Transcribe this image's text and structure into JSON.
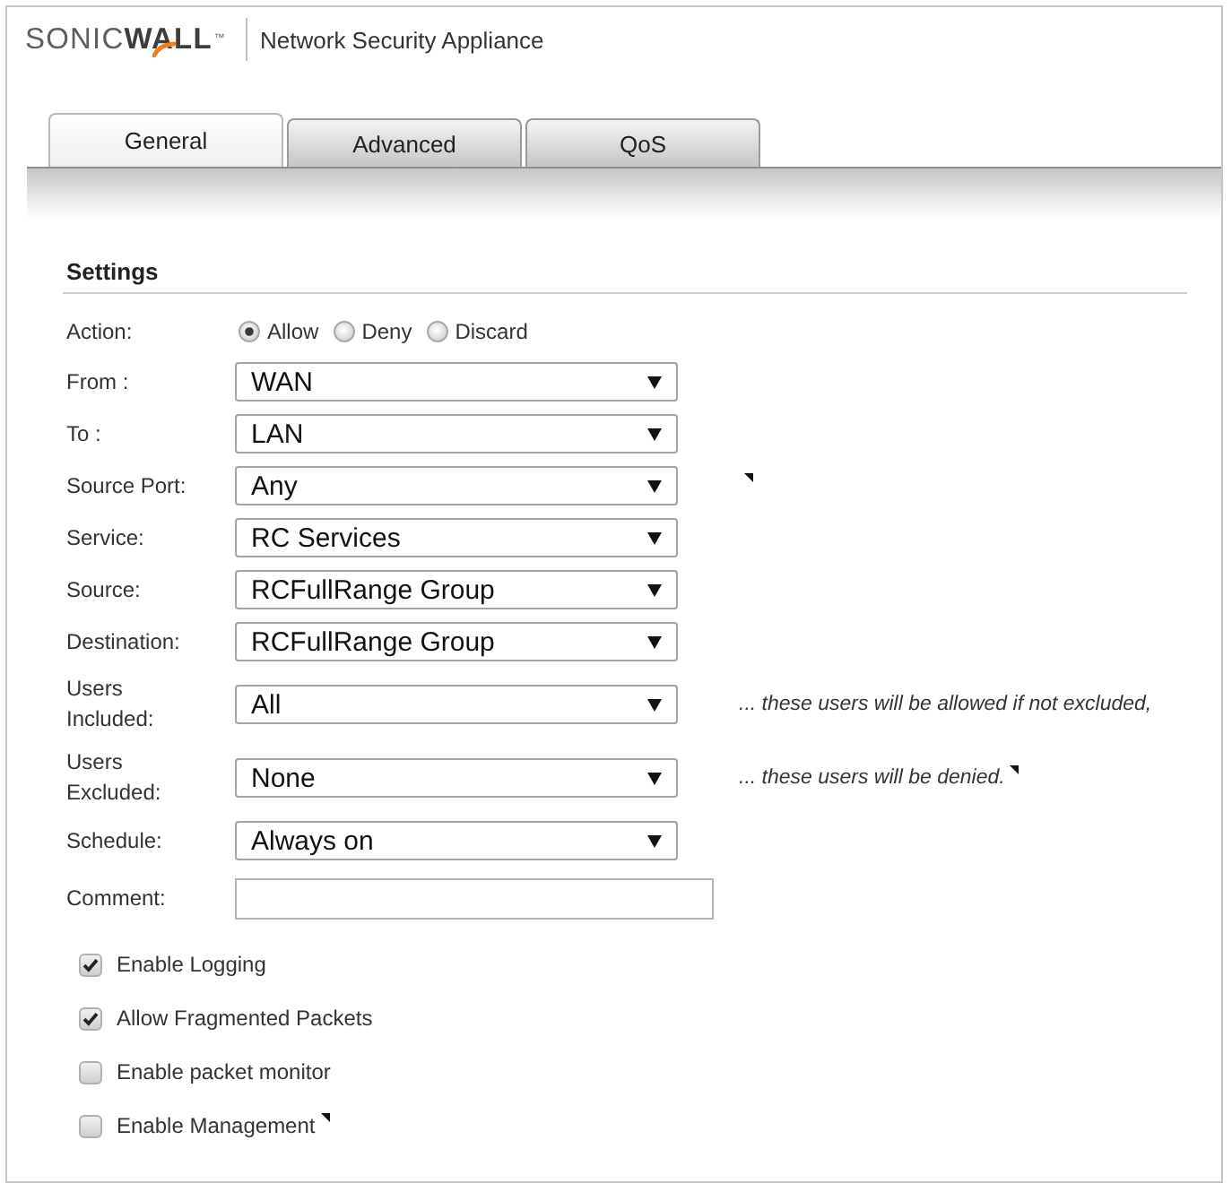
{
  "header": {
    "logo": "SONIC**WALL**$^{™}$",
    "product": "Network Security Appliance"
  },
  "tabs": [
    {
      "label": "General",
      "selected": true
    },
    {
      "label": "Advanced",
      "selected": false
    },
    {
      "label": "QoS",
      "selected": false
    }
  ],
  "settings": {
    "title": "Settings",
    "action": {
      "label": "Action:",
      "options": [
        {
          "label": "Allow",
          "selected": true
        },
        {
          "label": "Deny",
          "selected": false
        },
        {
          "label": "Discard",
          "selected": false
        }
      ]
    },
    "fields": [
      {
        "kind": "select",
        "label": "From :",
        "value": "WAN",
        "tooltip": false
      },
      {
        "kind": "select",
        "label": "To :",
        "value": "LAN",
        "tooltip": false
      },
      {
        "kind": "select",
        "label": "Source Port:",
        "value": "Any",
        "tooltip": true
      },
      {
        "kind": "select",
        "label": "Service:",
        "value": "RC Services",
        "tooltip": false
      },
      {
        "kind": "select",
        "label": "Source:",
        "value": "RCFullRange Group",
        "tooltip": false
      },
      {
        "kind": "select",
        "label": "Destination:",
        "value": "RCFullRange Group",
        "tooltip": false
      },
      {
        "kind": "select",
        "label": "Users Included:",
        "value": "All",
        "note": "... these users will be allowed if not excluded,",
        "tooltip": false
      },
      {
        "kind": "select",
        "label": "Users Excluded:",
        "value": "None",
        "note": "... these users will be denied.",
        "tooltip": true
      },
      {
        "kind": "select",
        "label": "Schedule:",
        "value": "Always on",
        "tooltip": false
      },
      {
        "kind": "text",
        "label": "Comment:",
        "tooltip": false
      }
    ],
    "options": [
      {
        "label": "Enable Logging",
        "checked": true,
        "tooltip": false
      },
      {
        "label": "Allow Fragmented Packets",
        "checked": true,
        "tooltip": false
      },
      {
        "label": "Enable packet monitor",
        "checked": false,
        "tooltip": false
      },
      {
        "label": "Enable Management",
        "checked": false,
        "tooltip": true
      }
    ]
  }
}
